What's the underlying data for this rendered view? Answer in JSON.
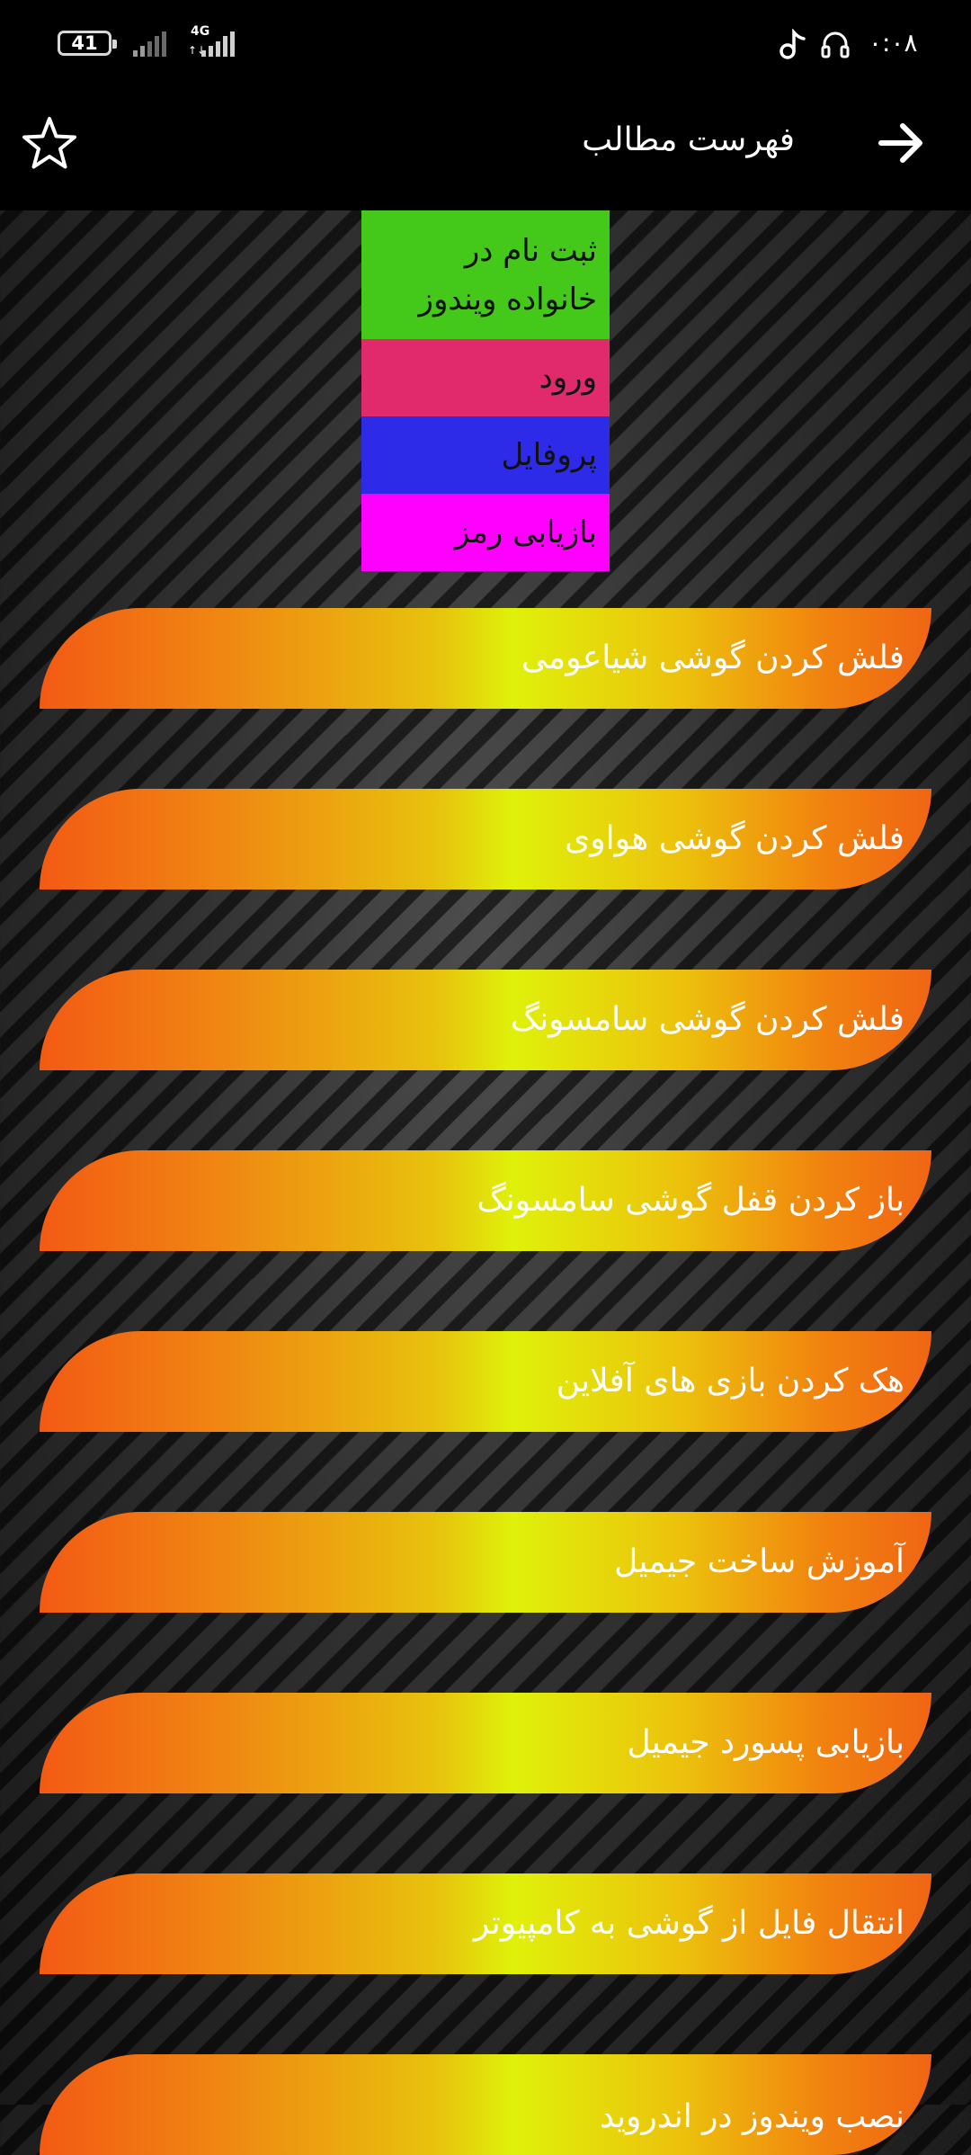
{
  "status_bar": {
    "battery": "41",
    "network_type": "4G",
    "network_arrows": "↑↓",
    "time": "۰:۰۸",
    "icons": [
      "music-note-icon",
      "headset-icon",
      "signal-icon"
    ]
  },
  "app_bar": {
    "title": "فهرست مطالب",
    "icons": [
      "star-icon",
      "arrow-right-icon"
    ]
  },
  "menu": {
    "items": [
      {
        "label": "ثبت نام در خانواده ویندوز",
        "color": "#44c91b"
      },
      {
        "label": "ورود",
        "color": "#e02a6c"
      },
      {
        "label": "پروفایل",
        "color": "#2d2ae8"
      },
      {
        "label": "بازیابی رمز",
        "color": "#ff00ff"
      }
    ]
  },
  "list": {
    "items": [
      {
        "label": "فلش کردن گوشی شیاعومی"
      },
      {
        "label": "فلش کردن گوشی هواوی"
      },
      {
        "label": "فلش کردن گوشی سامسونگ"
      },
      {
        "label": "باز کردن قفل گوشی سامسونگ"
      },
      {
        "label": "هک کردن بازی های آفلاین"
      },
      {
        "label": "آموزش ساخت جیمیل"
      },
      {
        "label": "بازیابی پسورد جیمیل"
      },
      {
        "label": "انتقال فایل از گوشی به کامپیوتر"
      },
      {
        "label": "نصب ویندوز در اندروید"
      }
    ]
  },
  "colors": {
    "status_bar_bg": "#000000",
    "app_bar_bg": "#000000",
    "item_gradient_edge": "#f35a14",
    "item_gradient_center": "#dff10a"
  }
}
